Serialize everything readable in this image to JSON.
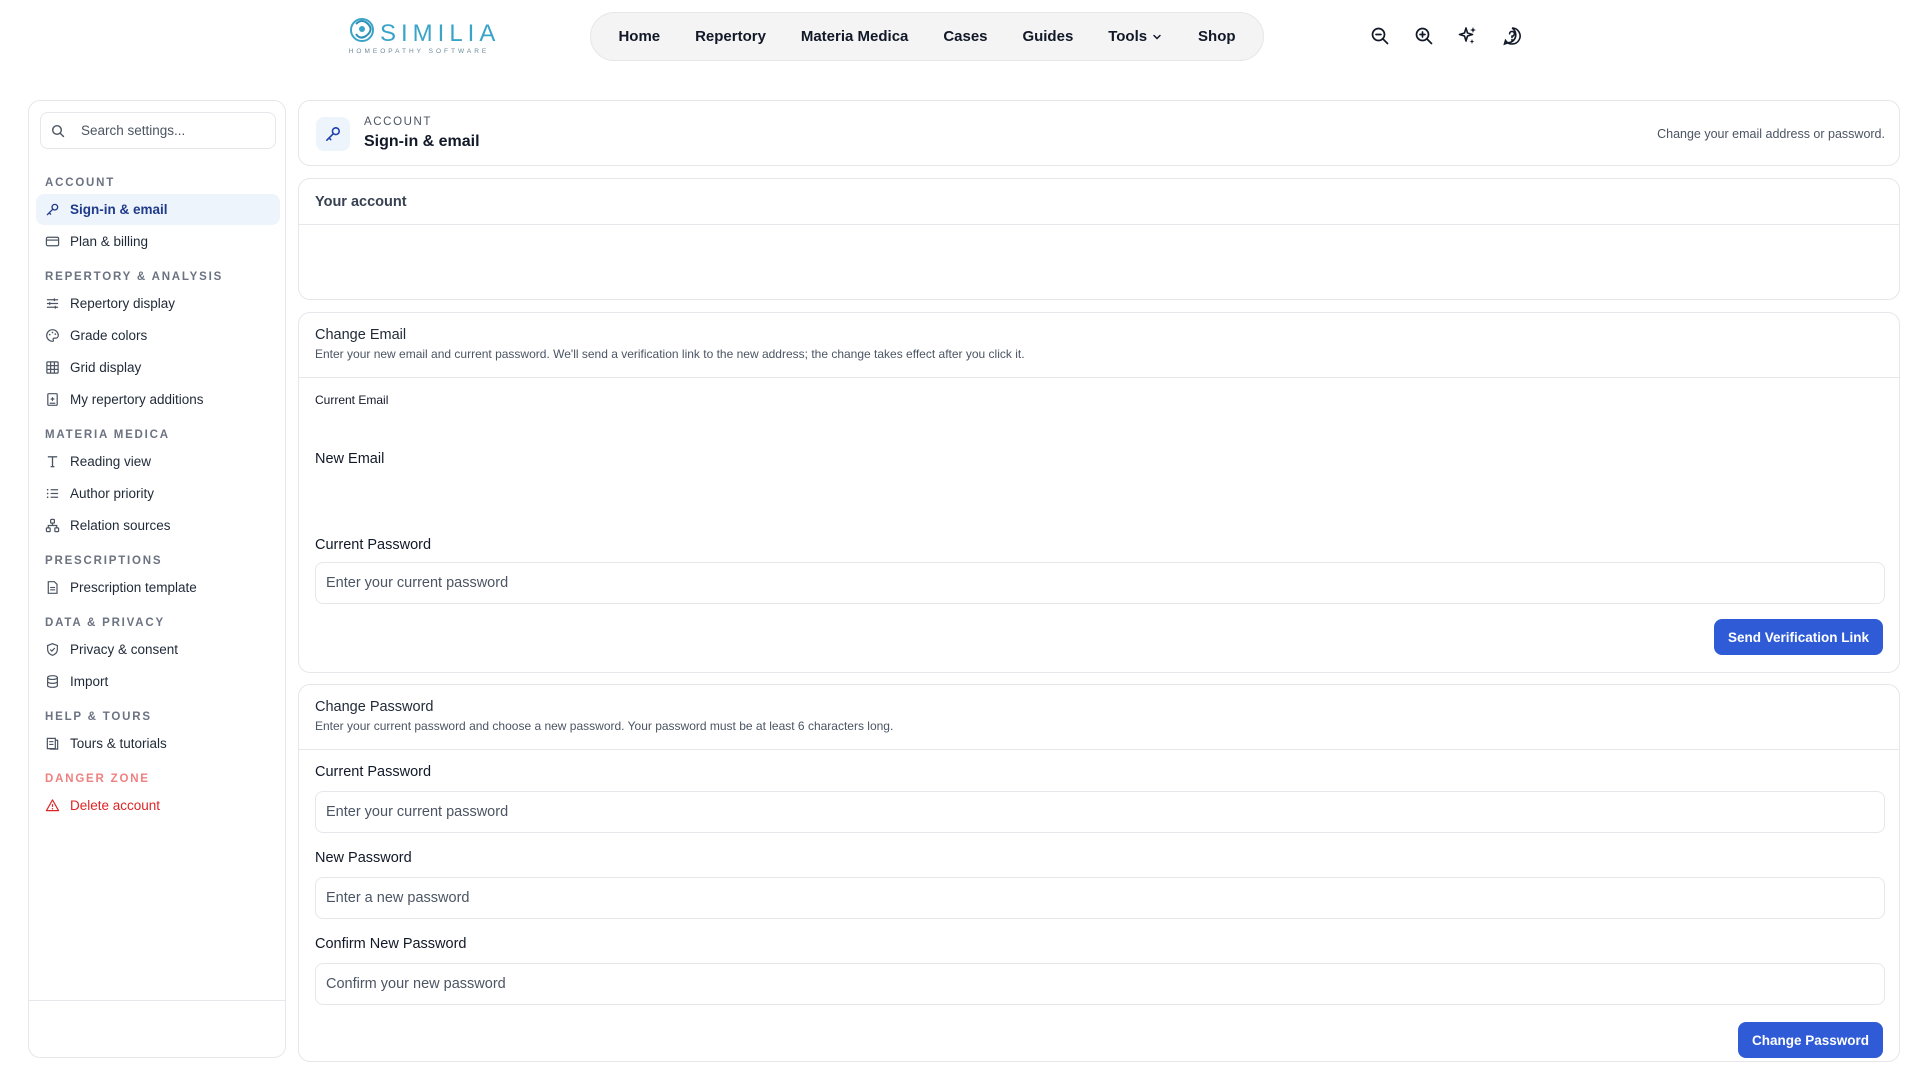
{
  "brand": {
    "name": "SIMILIA",
    "tagline": "HOMEOPATHY SOFTWARE",
    "color": "#3aa4c8"
  },
  "nav": {
    "items": [
      {
        "label": "Home"
      },
      {
        "label": "Repertory"
      },
      {
        "label": "Materia Medica"
      },
      {
        "label": "Cases"
      },
      {
        "label": "Guides"
      },
      {
        "label": "Tools"
      },
      {
        "label": "Shop"
      }
    ],
    "icons": [
      "zoom-out-icon",
      "zoom-in-icon",
      "sparkles-icon",
      "help-icon"
    ]
  },
  "sidebar": {
    "search_placeholder": "Search settings...",
    "sections": [
      {
        "label": "ACCOUNT",
        "items": [
          {
            "label": "Sign-in & email",
            "icon": "key-icon",
            "active": true
          },
          {
            "label": "Plan & billing",
            "icon": "credit-card-icon"
          }
        ]
      },
      {
        "label": "REPERTORY & ANALYSIS",
        "items": [
          {
            "label": "Repertory display",
            "icon": "sliders-icon"
          },
          {
            "label": "Grade colors",
            "icon": "palette-icon"
          },
          {
            "label": "Grid display",
            "icon": "grid-icon"
          },
          {
            "label": "My repertory additions",
            "icon": "book-plus-icon"
          }
        ]
      },
      {
        "label": "MATERIA MEDICA",
        "items": [
          {
            "label": "Reading view",
            "icon": "type-icon"
          },
          {
            "label": "Author priority",
            "icon": "list-ordered-icon"
          },
          {
            "label": "Relation sources",
            "icon": "network-icon"
          }
        ]
      },
      {
        "label": "PRESCRIPTIONS",
        "items": [
          {
            "label": "Prescription template",
            "icon": "file-text-icon"
          }
        ]
      },
      {
        "label": "DATA & PRIVACY",
        "items": [
          {
            "label": "Privacy & consent",
            "icon": "shield-check-icon"
          },
          {
            "label": "Import",
            "icon": "database-icon"
          }
        ]
      },
      {
        "label": "HELP & TOURS",
        "items": [
          {
            "label": "Tours & tutorials",
            "icon": "book-icon"
          }
        ]
      },
      {
        "label": "DANGER ZONE",
        "danger": true,
        "items": [
          {
            "label": "Delete account",
            "icon": "warning-icon",
            "danger": true
          }
        ]
      }
    ]
  },
  "header": {
    "kicker": "ACCOUNT",
    "title": "Sign-in & email",
    "description": "Change your email address or password."
  },
  "account": {
    "title": "Your account"
  },
  "change_email": {
    "title": "Change Email",
    "description": "Enter your new email and current password. We'll send a verification link to the new address; the change takes effect after you click it.",
    "current_email_label": "Current Email",
    "new_email_label": "New Email",
    "current_password_label": "Current Password",
    "current_password_placeholder": "Enter your current password",
    "submit_label": "Send Verification Link"
  },
  "change_password": {
    "title": "Change Password",
    "description": "Enter your current password and choose a new password. Your password must be at least 6 characters long.",
    "current_password_label": "Current Password",
    "current_password_placeholder": "Enter your current password",
    "new_password_label": "New Password",
    "new_password_placeholder": "Enter a new password",
    "confirm_password_label": "Confirm New Password",
    "confirm_password_placeholder": "Confirm your new password",
    "submit_label": "Change Password"
  },
  "colors": {
    "accent": "#2f5bd6",
    "active_bg": "#eef4fb",
    "danger": "#dc2626"
  }
}
